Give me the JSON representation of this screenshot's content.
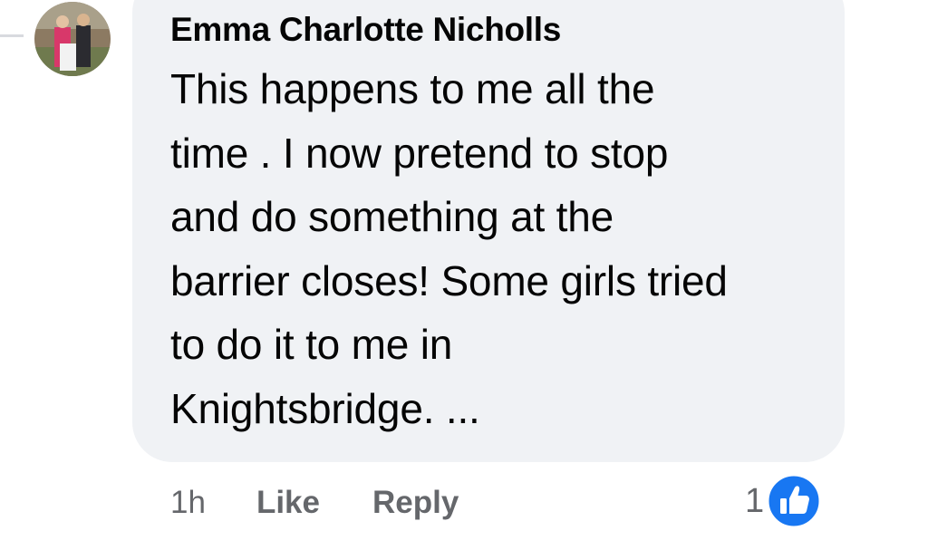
{
  "comment": {
    "author": "Emma Charlotte Nicholls",
    "text": "This happens to me all the\ntime . I now pretend to stop\nand do something at the\nbarrier closes! Some girls tried\nto do it to me in\nKnightsbridge. ...",
    "timestamp": "1h",
    "like_label": "Like",
    "reply_label": "Reply",
    "reaction_count": "1",
    "reaction_icon": "like-thumbs-up-icon"
  },
  "colors": {
    "bubble": "#f0f2f5",
    "text": "#050505",
    "secondary": "#65676b",
    "like_blue": "#1877f2"
  }
}
